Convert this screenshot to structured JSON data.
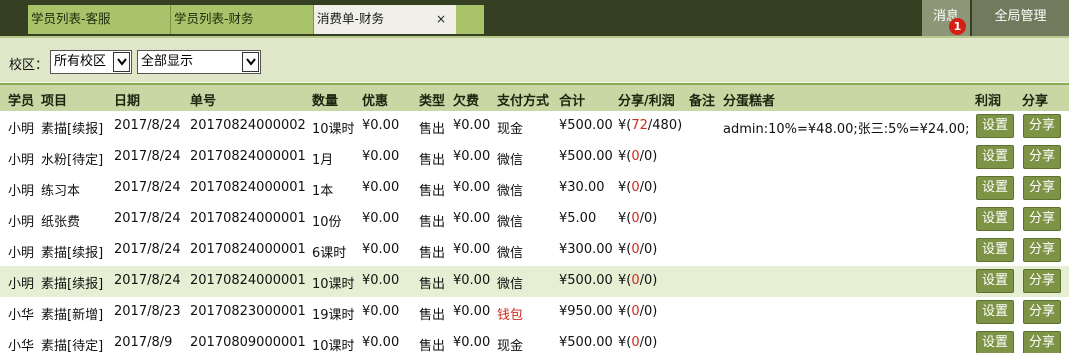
{
  "tabs": [
    {
      "label": "学员列表-客服"
    },
    {
      "label": "学员列表-财务"
    },
    {
      "label": "消费单-财务",
      "close": "×"
    }
  ],
  "top_buttons": {
    "messages": "消息",
    "messages_badge": "1",
    "global": "全局管理"
  },
  "filters": {
    "campus_label": "校区：",
    "campus_value": "所有校区",
    "display_value": "全部显示"
  },
  "table": {
    "headers": [
      "学员",
      "项目",
      "日期",
      "单号",
      "数量",
      "优惠",
      "类型",
      "欠费",
      "支付方式",
      "合计",
      "分享/利润",
      "备注",
      "分蛋糕者",
      "利润",
      "分享"
    ],
    "action_labels": {
      "profit": "设置",
      "share": "分享"
    },
    "rows": [
      {
        "student": "小明",
        "item": "素描[续报]",
        "date": "2017/8/24",
        "order": "20170824000002",
        "qty": "10课时",
        "discount": "¥0.00",
        "type": "售出",
        "owed": "¥0.00",
        "pay": "现金",
        "total": "¥500.00",
        "share_pre": "¥(",
        "share_val": "72",
        "share_post": "/480)",
        "note": "",
        "cake": "admin:10%=¥48.00;张三:5%=¥24.00;"
      },
      {
        "student": "小明",
        "item": "水粉[待定]",
        "date": "2017/8/24",
        "order": "20170824000001",
        "qty": "1月",
        "discount": "¥0.00",
        "type": "售出",
        "owed": "¥0.00",
        "pay": "微信",
        "total": "¥500.00",
        "share_pre": "¥(",
        "share_val": "0",
        "share_post": "/0)",
        "note": "",
        "cake": ""
      },
      {
        "student": "小明",
        "item": "练习本",
        "date": "2017/8/24",
        "order": "20170824000001",
        "qty": "1本",
        "discount": "¥0.00",
        "type": "售出",
        "owed": "¥0.00",
        "pay": "微信",
        "total": "¥30.00",
        "share_pre": "¥(",
        "share_val": "0",
        "share_post": "/0)",
        "note": "",
        "cake": ""
      },
      {
        "student": "小明",
        "item": "纸张费",
        "date": "2017/8/24",
        "order": "20170824000001",
        "qty": "10份",
        "discount": "¥0.00",
        "type": "售出",
        "owed": "¥0.00",
        "pay": "微信",
        "total": "¥5.00",
        "share_pre": "¥(",
        "share_val": "0",
        "share_post": "/0)",
        "note": "",
        "cake": ""
      },
      {
        "student": "小明",
        "item": "素描[续报]",
        "date": "2017/8/24",
        "order": "20170824000001",
        "qty": "6课时",
        "discount": "¥0.00",
        "type": "售出",
        "owed": "¥0.00",
        "pay": "微信",
        "total": "¥300.00",
        "share_pre": "¥(",
        "share_val": "0",
        "share_post": "/0)",
        "note": "",
        "cake": ""
      },
      {
        "student": "小明",
        "item": "素描[续报]",
        "date": "2017/8/24",
        "order": "20170824000001",
        "qty": "10课时",
        "discount": "¥0.00",
        "type": "售出",
        "owed": "¥0.00",
        "pay": "微信",
        "total": "¥500.00",
        "share_pre": "¥(",
        "share_val": "0",
        "share_post": "/0)",
        "note": "",
        "cake": ""
      },
      {
        "student": "小华",
        "item": "素描[新增]",
        "date": "2017/8/23",
        "order": "20170823000001",
        "qty": "19课时",
        "discount": "¥0.00",
        "type": "售出",
        "owed": "¥0.00",
        "pay": "钱包",
        "total": "¥950.00",
        "share_pre": "¥(",
        "share_val": "0",
        "share_post": "/0)",
        "note": "",
        "cake": ""
      },
      {
        "student": "小华",
        "item": "素描[待定]",
        "date": "2017/8/9",
        "order": "20170809000001",
        "qty": "10课时",
        "discount": "¥0.00",
        "type": "售出",
        "owed": "¥0.00",
        "pay": "现金",
        "total": "¥500.00",
        "share_pre": "¥(",
        "share_val": "0",
        "share_post": "/0)",
        "note": "",
        "cake": ""
      }
    ]
  },
  "colors": {
    "accent": "#7d9446",
    "topbar": "#353f21",
    "header": "#c9d7a4",
    "highlight_row": "#e6efd3",
    "alert_red": "#d0281b",
    "wallet_red": "#d0281b"
  },
  "highlighted_row_index": 5,
  "red_pay_methods": [
    "钱包"
  ]
}
